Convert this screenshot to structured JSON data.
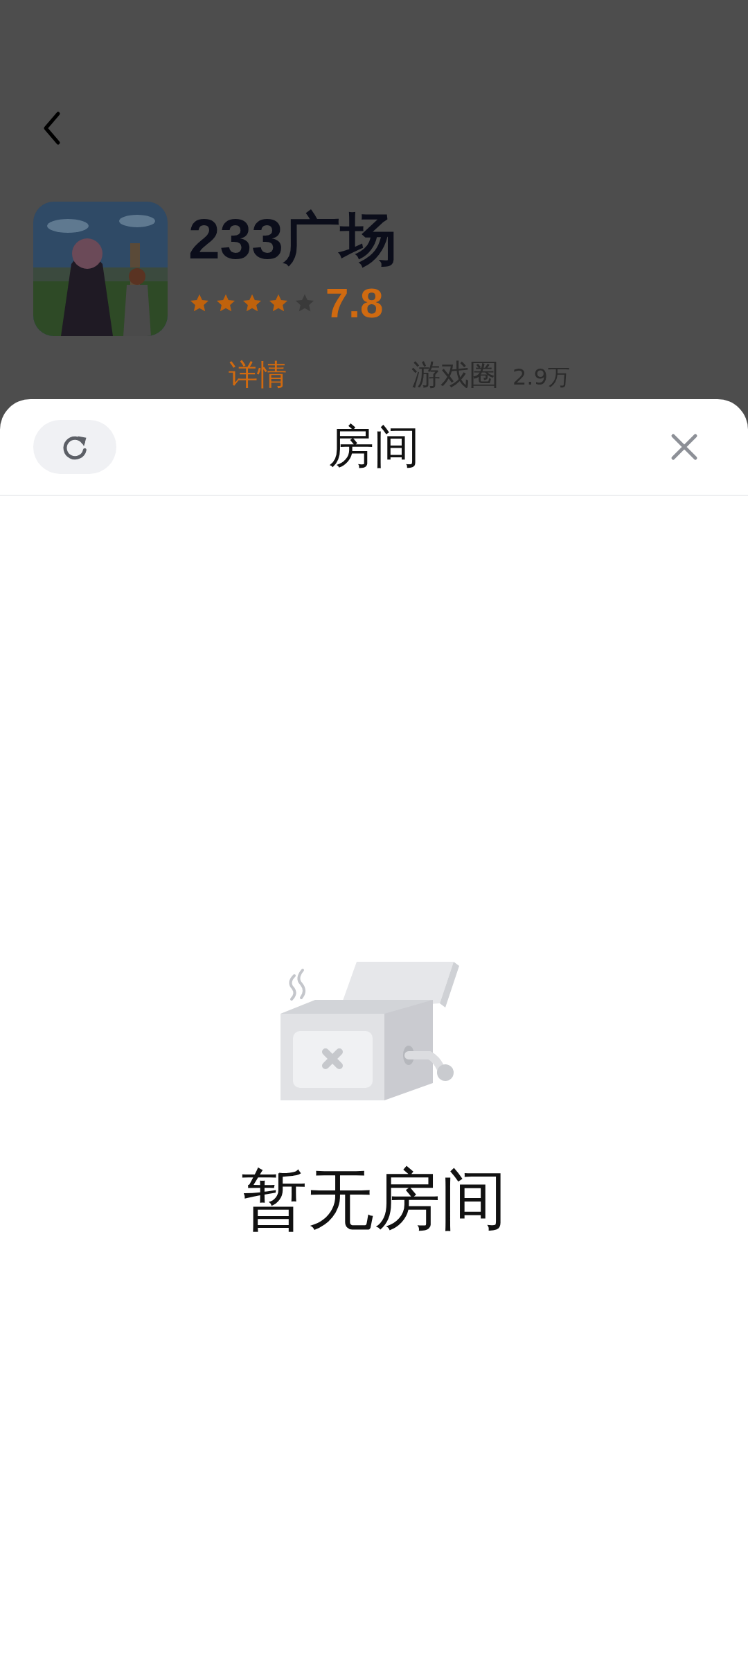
{
  "game": {
    "title": "233广场",
    "stars": 4,
    "score": "7.8"
  },
  "tabs": [
    {
      "label": "详情",
      "selected": true
    },
    {
      "label": "游戏圈",
      "count": "2.9万",
      "selected": false
    }
  ],
  "sheet": {
    "title": "房间",
    "empty_text": "暂无房间"
  }
}
